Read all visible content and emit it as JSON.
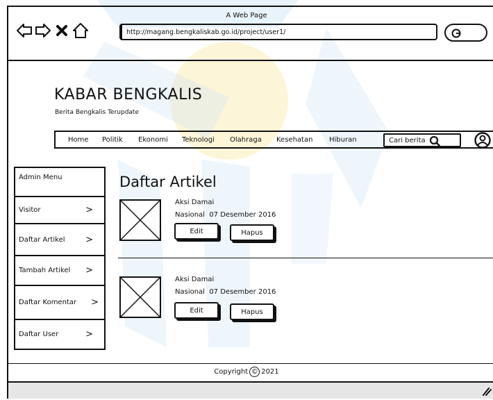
{
  "window": {
    "title": "A Web Page",
    "url": "http://magang.bengkaliskab.go.id/project/user1/"
  },
  "site": {
    "title": "KABAR BENGKALIS",
    "tagline": "Berita Bengkalis Terupdate"
  },
  "nav": {
    "items": [
      "Home",
      "Politik",
      "Ekonomi",
      "Teknologi",
      "Olahraga",
      "Kesehatan",
      "Hiburan"
    ],
    "search_placeholder": "Cari berita"
  },
  "sidebar": {
    "header": "Admin Menu",
    "items": [
      {
        "label": "Visitor",
        "chevron": ">"
      },
      {
        "label": "Daftar Artikel",
        "chevron": ">"
      },
      {
        "label": "Tambah Artikel",
        "chevron": ">"
      },
      {
        "label": "Daftar Komentar",
        "chevron": ">"
      },
      {
        "label": "Daftar User",
        "chevron": ">"
      }
    ]
  },
  "main": {
    "heading": "Daftar Artikel",
    "articles": [
      {
        "title": "Aksi Damai",
        "meta": "Nasional  07 Desember 2016",
        "edit_label": "Edit",
        "delete_label": "Hapus"
      },
      {
        "title": "Aksi Damai",
        "meta": "Nasional  07 Desember 2016",
        "edit_label": "Edit",
        "delete_label": "Hapus"
      }
    ]
  },
  "footer": {
    "copyright": "Copyright",
    "copyright_symbol": "©",
    "year": "2021"
  },
  "colors": {
    "frame": "#111111",
    "chrome_bg": "#ffffff",
    "status_bar_bg": "#e6e6e6"
  }
}
